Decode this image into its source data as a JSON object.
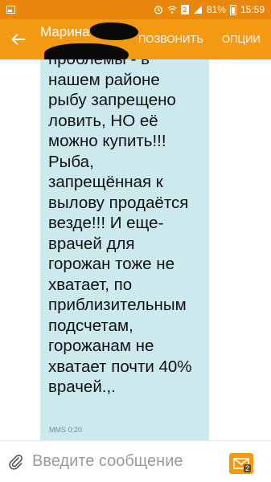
{
  "status_bar": {
    "battery_percent": "81%",
    "time": "15:59",
    "sim_label": "2"
  },
  "header": {
    "contact_name": "Марина",
    "call_label": "ПОЗВОНИТЬ",
    "options_label": "ОПЦИИ"
  },
  "message": {
    "text": "проблемы - в\nнашем районе\nрыбу запрещено\nловить, НО её\nможно купить!!!\nРыба,\nзапрещённая к\nвылову продаётся\nвезде!!! И еще-\nврачей для\nгорожан тоже не\nхватает, по\nприблизительным\nподсчетам,\nгорожанам не\nхватает почти 40%\nврачей.,.",
    "meta": "MMS 0:20"
  },
  "composer": {
    "placeholder": "Введите сообщение",
    "value": "",
    "send_count": "2"
  },
  "icons": {
    "back": "arrow-left-icon",
    "attach": "paperclip-icon",
    "send": "envelope-icon"
  },
  "colors": {
    "status_bar": "#e8870b",
    "action_bar": "#f39a12",
    "bubble": "#cce9ee"
  }
}
